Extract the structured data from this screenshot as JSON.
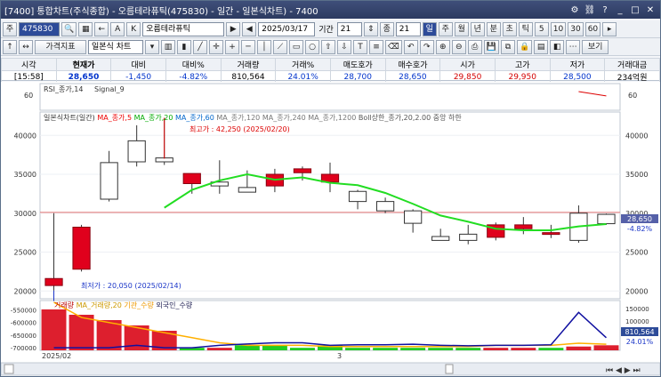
{
  "window": {
    "title": "[7400] 통합차트(주식종합) - 오름테라퓨틱(475830) - 일간 - 일본식차트) - 7400"
  },
  "toolbar1": {
    "menu_label": "주",
    "code": "475830",
    "name": "오름테라퓨틱",
    "date": "2025/03/17",
    "period_label": "기간",
    "period_value": "21",
    "count_label": "종",
    "count_value": "21",
    "period_buttons": [
      "일",
      "주",
      "월",
      "년",
      "분",
      "초",
      "틱",
      "5",
      "10",
      "30",
      "60"
    ]
  },
  "toolbar2": {
    "indicator_label": "가격지표",
    "chart_type": "일본식 차트",
    "view_label": "보기"
  },
  "quote": {
    "headers": [
      "시각",
      "현재가",
      "대비",
      "대비%",
      "거래량",
      "거래%",
      "매도호가",
      "매수호가",
      "시가",
      "고가",
      "저가",
      "거래대금"
    ],
    "values": [
      "[15:58]",
      "28,650",
      "-1,450",
      "-4.82%",
      "810,564",
      "24.01%",
      "28,700",
      "28,650",
      "29,850",
      "29,950",
      "28,500",
      "234억원"
    ]
  },
  "indicators": {
    "rsi_legend": "RSI_종가,14",
    "rsi_signal": "Signal_9",
    "rsi_level": "60",
    "price_legend": [
      "일본식차트(일간)",
      "MA_종가,5",
      "MA_종가,20",
      "MA_종가,60",
      "MA_종가,120",
      "MA_종가,240",
      "MA_종가,1200",
      "Boll상한_종가,20,2.00",
      "중앙",
      "하한"
    ],
    "high_note": "최고가 : 42,250 (2025/02/20)",
    "low_note": "최저가 : 20,050 (2025/02/14)",
    "volume_legend": [
      "거래량",
      "MA_거래량,20",
      "기관_수량",
      "외국인_수량"
    ],
    "current_price_tag": "28,650",
    "change_tag": "-4.82%",
    "volume_tag": "810,564",
    "volume_pct_tag": "24.01%",
    "x_labels": [
      "2025/02",
      "3"
    ]
  },
  "colors": {
    "up": "#e0001c",
    "down": "#1a35c8",
    "ma5": "#ff0000",
    "ma20": "#22dd22",
    "inst": "#ffb000",
    "foreign": "#1010a0"
  },
  "chart_data": {
    "type": "candlestick",
    "dates": [
      "2025/02/14",
      "2025/02/17",
      "2025/02/18",
      "2025/02/19",
      "2025/02/20",
      "2025/02/21",
      "2025/02/24",
      "2025/02/25",
      "2025/02/26",
      "2025/02/27",
      "2025/02/28",
      "2025/03/04",
      "2025/03/05",
      "2025/03/06",
      "2025/03/07",
      "2025/03/10",
      "2025/03/11",
      "2025/03/12",
      "2025/03/13",
      "2025/03/14",
      "2025/03/17"
    ],
    "open": [
      20700,
      22800,
      36500,
      39300,
      37100,
      33800,
      34000,
      33300,
      33500,
      35200,
      34000,
      32800,
      31500,
      30300,
      27000,
      27300,
      26900,
      28000,
      27300,
      30000,
      29850
    ],
    "high": [
      30000,
      28500,
      38000,
      41300,
      42250,
      35000,
      36800,
      35500,
      35700,
      36000,
      36500,
      33000,
      32000,
      30500,
      28000,
      28500,
      28800,
      29500,
      28500,
      31000,
      29950
    ],
    "low": [
      20050,
      22500,
      31500,
      36000,
      36200,
      32500,
      32500,
      32800,
      32700,
      34200,
      32700,
      30500,
      30000,
      27500,
      26500,
      26000,
      26500,
      27300,
      26800,
      26200,
      28500
    ],
    "close": [
      21600,
      28200,
      31800,
      36600,
      36600,
      35100,
      33500,
      32700,
      35000,
      35700,
      35000,
      31500,
      30300,
      28700,
      26500,
      26500,
      28500,
      28500,
      27500,
      26500,
      28650
    ],
    "ma5": [
      null,
      null,
      null,
      null,
      null,
      null,
      null,
      null,
      null,
      null,
      null,
      null,
      null,
      null,
      null,
      null,
      null,
      null,
      null,
      null,
      null
    ],
    "ma20": [
      null,
      null,
      null,
      null,
      30700,
      33000,
      34200,
      35000,
      34300,
      34600,
      33900,
      33600,
      32600,
      31200,
      29700,
      28900,
      28000,
      27800,
      27800,
      28300,
      28600
    ],
    "volume": [
      690000,
      620000,
      610000,
      580000,
      610000,
      700000,
      700000,
      690000,
      690000,
      700000,
      690000,
      700000,
      700000,
      700000,
      700000,
      700000,
      700000,
      700000,
      700000,
      695000,
      690000
    ],
    "vol_up": [
      true,
      false,
      false,
      true,
      false,
      true,
      false,
      true,
      true,
      true,
      true,
      true,
      true,
      true,
      true,
      true,
      false,
      false,
      true,
      false,
      false
    ],
    "inst_qty": [
      -520000,
      -580000,
      -600000,
      -620000,
      -640000,
      -660000,
      -680000,
      -690000,
      -690000,
      -690000,
      -695000,
      -695000,
      -695000,
      -695000,
      -695000,
      -695000,
      -690000,
      -690000,
      -690000,
      -682000,
      -686000
    ],
    "foreign_qty": [
      -700000,
      -700000,
      -700000,
      -690000,
      -700000,
      -700000,
      -690000,
      -685000,
      -680000,
      -680000,
      -690000,
      -688000,
      -688000,
      -686000,
      -690000,
      -692000,
      -690000,
      -690000,
      -688000,
      -560000,
      -660000
    ],
    "rsi": [
      null,
      null,
      null,
      null,
      null,
      null,
      null,
      null,
      null,
      null,
      null,
      null,
      null,
      null,
      null,
      null,
      null,
      null,
      null,
      70,
      63
    ],
    "price_ylim": [
      19000,
      43000
    ],
    "price_ticks": [
      20000,
      25000,
      30000,
      35000,
      40000
    ],
    "volume_ticks": [
      "-550000",
      "-600000",
      "-650000",
      "-700000"
    ],
    "volume_ticks_right": [
      "150000",
      "100000",
      "50000"
    ]
  }
}
